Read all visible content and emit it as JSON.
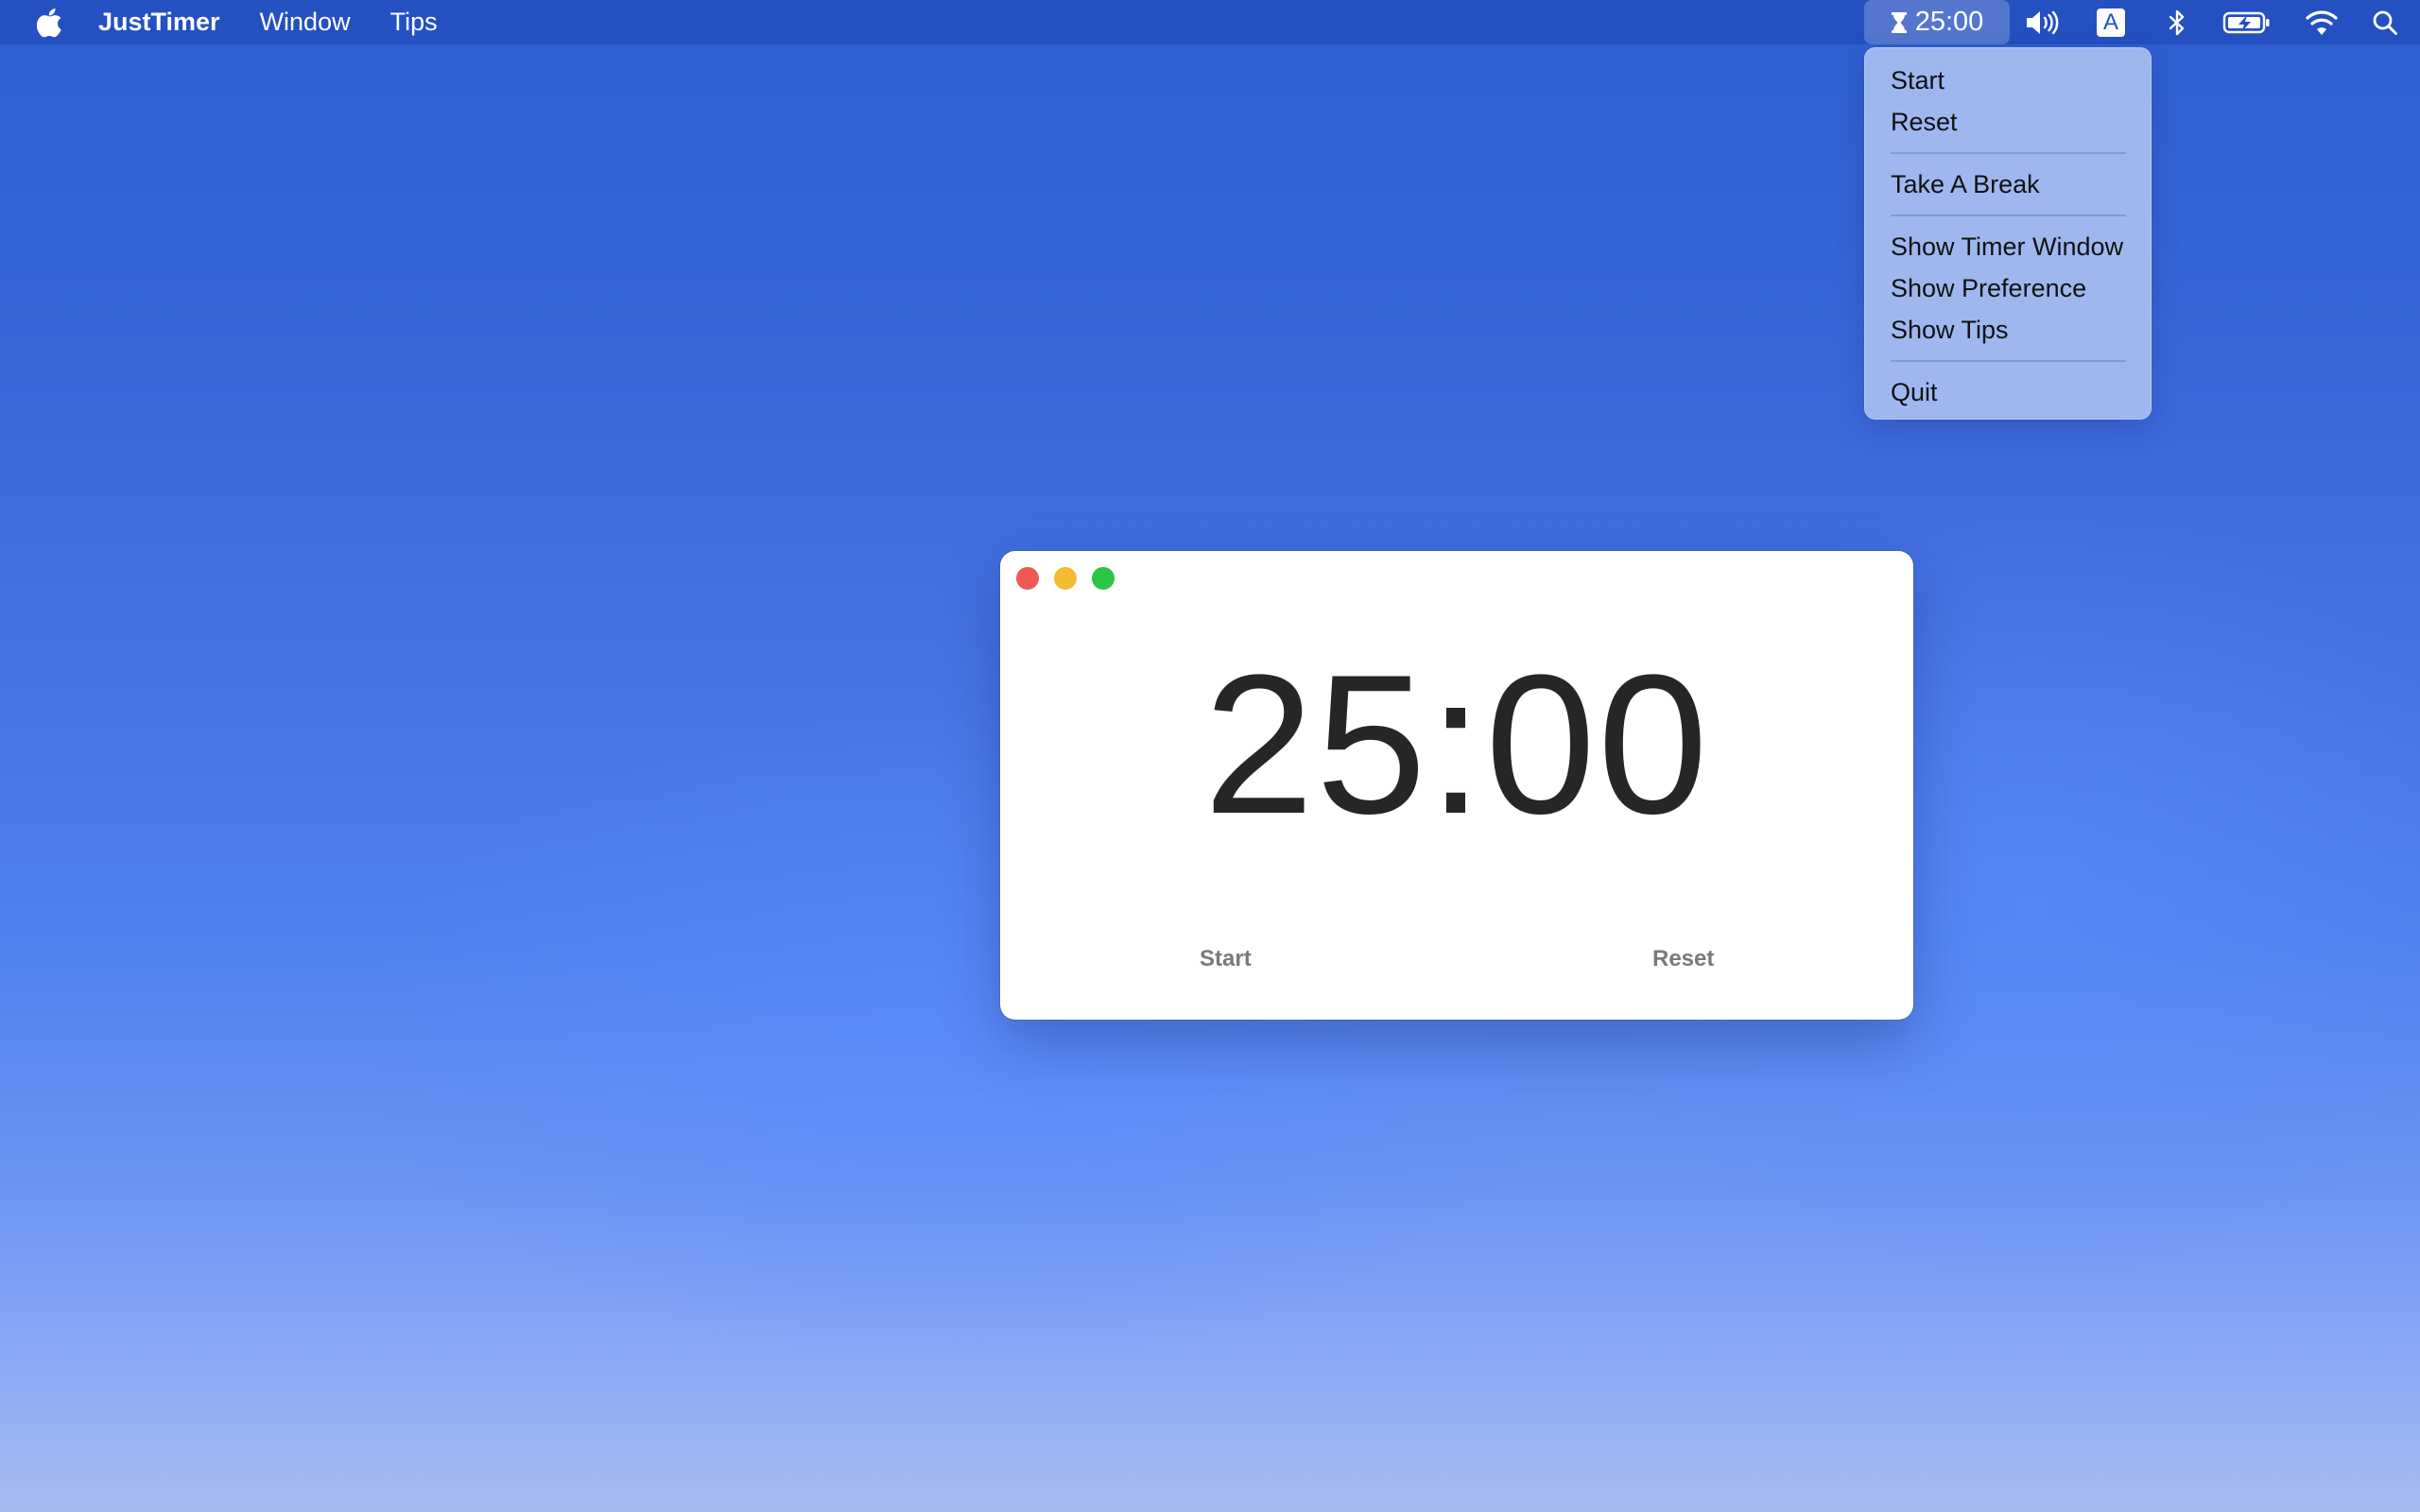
{
  "menubar": {
    "app_name": "JustTimer",
    "menus": [
      "Window",
      "Tips"
    ],
    "timer_status": "25:00",
    "input_source": "A",
    "icons": [
      "apple-icon",
      "hourglass-icon",
      "volume-icon",
      "input-source-icon",
      "bluetooth-icon",
      "battery-charging-icon",
      "wifi-icon",
      "spotlight-search-icon"
    ]
  },
  "dropdown": {
    "items": [
      "Start",
      "Reset",
      "Take A Break",
      "Show Timer Window",
      "Show Preference",
      "Show Tips",
      "Quit"
    ]
  },
  "timer_window": {
    "time": "25:00",
    "start_label": "Start",
    "reset_label": "Reset"
  },
  "colors": {
    "menubar": "#2550c2",
    "close": "#ee5a52",
    "minimize": "#f3bb2f",
    "zoom": "#2cc445"
  }
}
